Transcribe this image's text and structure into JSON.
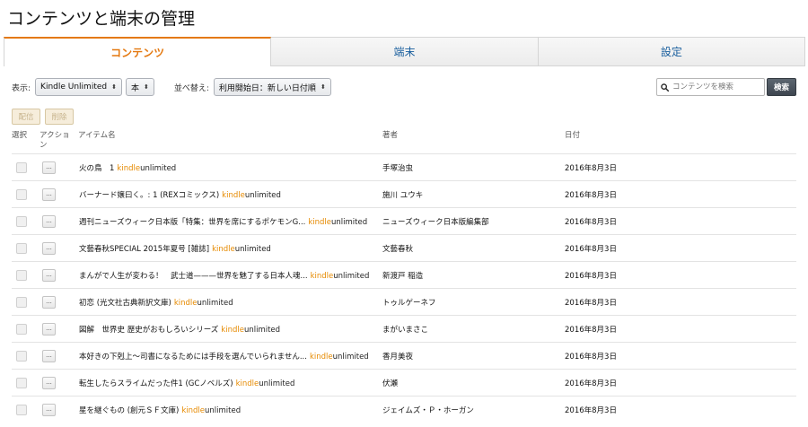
{
  "page": {
    "title": "コンテンツと端末の管理"
  },
  "tabs": [
    {
      "label": "コンテンツ",
      "active": true
    },
    {
      "label": "端末",
      "active": false
    },
    {
      "label": "設定",
      "active": false
    }
  ],
  "filters": {
    "display_label": "表示:",
    "program_value": "Kindle Unlimited",
    "type_value": "本",
    "sort_label": "並べ替え:",
    "sort_value": "利用開始日：新しい日付順"
  },
  "search": {
    "placeholder": "コンテンツを検索",
    "button_label": "検索"
  },
  "actions": {
    "deliver_label": "配信",
    "delete_label": "削除"
  },
  "table": {
    "headers": {
      "select": "選択",
      "action": "アクション",
      "item": "アイテム名",
      "author": "著者",
      "date": "日付"
    },
    "ku_kindle": "kindle",
    "ku_unlimited": "unlimited",
    "action_button_label": "...",
    "rows": [
      {
        "title": "火の鳥　1",
        "author": "手塚治虫",
        "date": "2016年8月3日"
      },
      {
        "title": "バーナード嬢曰く。: 1 (REXコミックス)",
        "author": "施川 ユウキ",
        "date": "2016年8月3日"
      },
      {
        "title": "週刊ニューズウィーク日本版「特集：世界を席にするポケモンG...",
        "author": "ニューズウィーク日本版編集部",
        "date": "2016年8月3日"
      },
      {
        "title": "文藝春秋SPECIAL 2015年夏号 [雑誌]",
        "author": "文藝春秋",
        "date": "2016年8月3日"
      },
      {
        "title": "まんがで人生が変わる！　武士道———世界を魅了する日本人魂...",
        "author": "新渡戸 稲造",
        "date": "2016年8月3日"
      },
      {
        "title": "初恋 (光文社古典新訳文庫)",
        "author": "トゥルゲーネフ",
        "date": "2016年8月3日"
      },
      {
        "title": "図解　世界史 歴史がおもしろいシリーズ",
        "author": "まがいまさこ",
        "date": "2016年8月3日"
      },
      {
        "title": "本好きの下剋上〜司書になるためには手段を選んでいられません...",
        "author": "香月美夜",
        "date": "2016年8月3日"
      },
      {
        "title": "転生したらスライムだった件1 (GCノベルズ)",
        "author": "伏瀬",
        "date": "2016年8月3日"
      },
      {
        "title": "星を継ぐもの (創元ＳＦ文庫)",
        "author": "ジェイムズ・Ｐ・ホーガン",
        "date": "2016年8月3日"
      }
    ]
  },
  "colors": {
    "accent": "#e47911",
    "link": "#1a5f9e",
    "kindle": "#e68a00"
  }
}
